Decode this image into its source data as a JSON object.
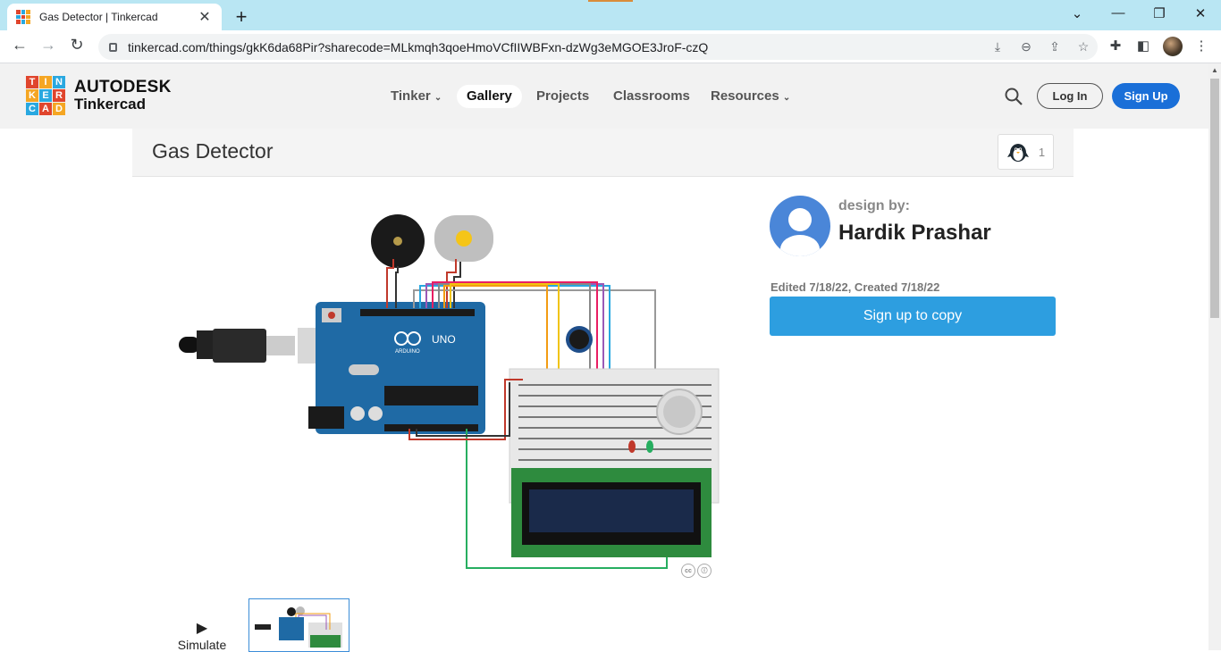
{
  "browser": {
    "tab_title": "Gas Detector | Tinkercad",
    "url": "tinkercad.com/things/gkK6da68Pir?sharecode=MLkmqh3qoeHmoVCfIIWBFxn-dzWg3eMGOE3JroF-czQ",
    "icons": [
      "back-icon",
      "forward-icon",
      "reload-icon",
      "lock-icon",
      "install-icon",
      "zoom-icon",
      "share-icon",
      "star-icon",
      "extensions-icon",
      "sidepanel-icon",
      "menu-icon"
    ]
  },
  "site": {
    "logo_letters": [
      "T",
      "I",
      "N",
      "K",
      "E",
      "R",
      "C",
      "A",
      "D"
    ],
    "logo_colors": [
      "#e0452d",
      "#f5a623",
      "#29a8e0",
      "#f5a623",
      "#29a8e0",
      "#e0452d",
      "#29a8e0",
      "#e0452d",
      "#f5a623"
    ],
    "brand_line1": "AUTODESK",
    "brand_line2": "Tinkercad",
    "nav": {
      "tinker": "Tinker",
      "gallery": "Gallery",
      "projects": "Projects",
      "classrooms": "Classrooms",
      "resources": "Resources"
    },
    "login": "Log In",
    "signup": "Sign Up",
    "accent": "#1a6fd8"
  },
  "design": {
    "title": "Gas Detector",
    "likes": "1",
    "design_by_label": "design by:",
    "author": "Hardik Prashar",
    "edited": "Edited 7/18/22, Created 7/18/22",
    "copy_button": "Sign up to copy",
    "simulate": "Simulate",
    "board_label": "UNO",
    "board_brand": "ARDUINO"
  }
}
